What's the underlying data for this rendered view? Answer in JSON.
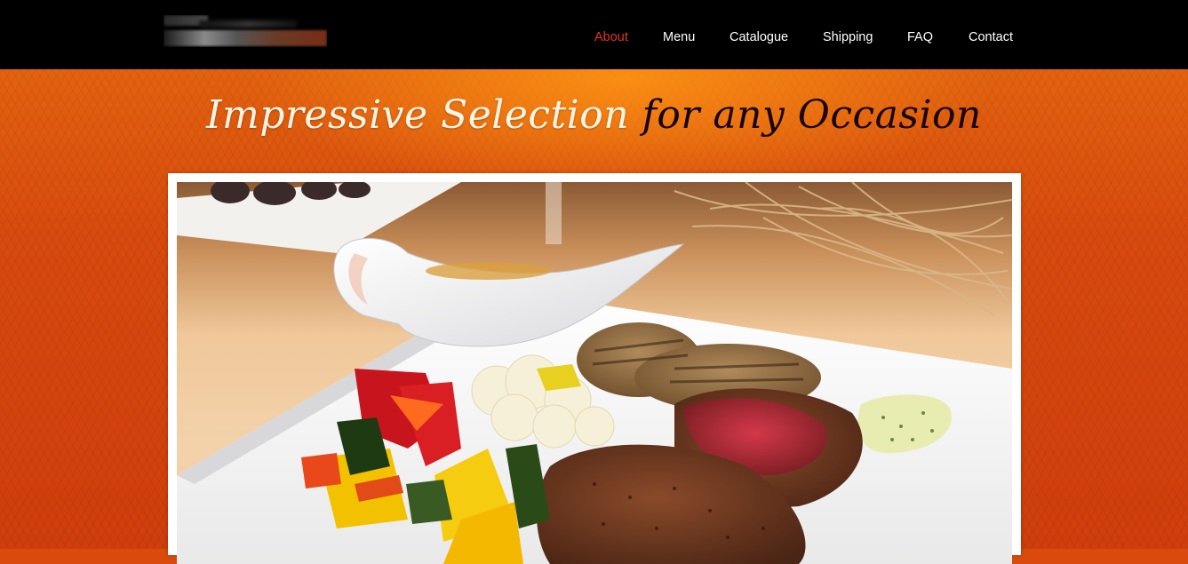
{
  "header": {
    "logo_name": "site-logo",
    "nav": [
      {
        "label": "About",
        "active": true
      },
      {
        "label": "Menu",
        "active": false
      },
      {
        "label": "Catalogue",
        "active": false
      },
      {
        "label": "Shipping",
        "active": false
      },
      {
        "label": "FAQ",
        "active": false
      },
      {
        "label": "Contact",
        "active": false
      }
    ]
  },
  "banner": {
    "headline_light": "Impressive Selection",
    "headline_dark": "for any Occasion"
  },
  "colors": {
    "header_bg": "#000000",
    "nav_text": "#ffffff",
    "nav_active": "#e2361c",
    "banner_orange": "#d94a0c",
    "headline_light": "#fff6e6",
    "headline_dark": "#150400"
  }
}
